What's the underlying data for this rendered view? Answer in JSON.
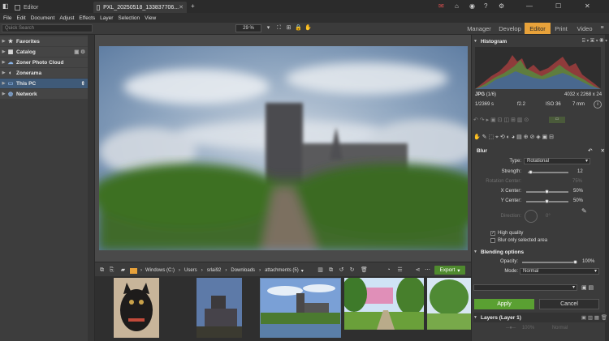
{
  "window": {
    "tabs": [
      {
        "label": "Editor"
      },
      {
        "label": "PXL_20250518_133837706..."
      }
    ],
    "new_tab": "+"
  },
  "menu": [
    "File",
    "Edit",
    "Document",
    "Adjust",
    "Effects",
    "Layer",
    "Selection",
    "View"
  ],
  "toolbar": {
    "search_placeholder": "Quick Search",
    "zoom": "29 %"
  },
  "modes": [
    "Manager",
    "Develop",
    "Editor",
    "Print",
    "Video"
  ],
  "active_mode": "Editor",
  "navigator": [
    {
      "label": "Favorites",
      "icon": "star-icon"
    },
    {
      "label": "Catalog",
      "icon": "catalog-icon"
    },
    {
      "label": "Zoner Photo Cloud",
      "icon": "cloud-icon"
    },
    {
      "label": "Zonerama",
      "icon": "zonerama-icon"
    },
    {
      "label": "This PC",
      "icon": "pc-icon"
    },
    {
      "label": "Network",
      "icon": "network-icon"
    }
  ],
  "breadcrumb": [
    "Windows (C:)",
    "Users",
    "srlai92",
    "Downloads",
    "attachments (5)"
  ],
  "export_label": "Export",
  "histogram": {
    "title": "Histogram",
    "format": "JPG",
    "index": "(1/6)",
    "dimensions": "4032 x 2268 x 24",
    "shutter": "1/2369 s",
    "aperture": "f2.2",
    "iso": "ISO 36",
    "focal": "7 mm",
    "info_button": "i"
  },
  "blur": {
    "title": "Blur",
    "type_label": "Type:",
    "type_value": "Rotational",
    "strength_label": "Strength:",
    "strength_value": "12",
    "strength_pct": 0.08,
    "rotation_label": "Rotation Center:",
    "rotation_value": "75%",
    "xcenter_label": "X Center:",
    "xcenter_value": "50%",
    "xcenter_pct": 0.5,
    "ycenter_label": "Y Center:",
    "ycenter_value": "50%",
    "ycenter_pct": 0.5,
    "direction_label": "Direction:",
    "direction_value": "0°",
    "high_quality": "High quality",
    "blur_only_selected": "Blur only selected area"
  },
  "blending": {
    "title": "Blending options",
    "opacity_label": "Opacity:",
    "opacity_value": "100%",
    "opacity_pct": 1.0,
    "mode_label": "Mode:",
    "mode_value": "Normal"
  },
  "actions": {
    "apply": "Apply",
    "cancel": "Cancel"
  },
  "layers": {
    "title": "Layers (Layer 1)",
    "opacity": "100%",
    "mode": "Normal"
  },
  "colors": {
    "accent": "#e8a23a",
    "apply_green": "#5aa032",
    "export_green": "#4f8a2e",
    "selection_blue": "#3f5a78"
  }
}
